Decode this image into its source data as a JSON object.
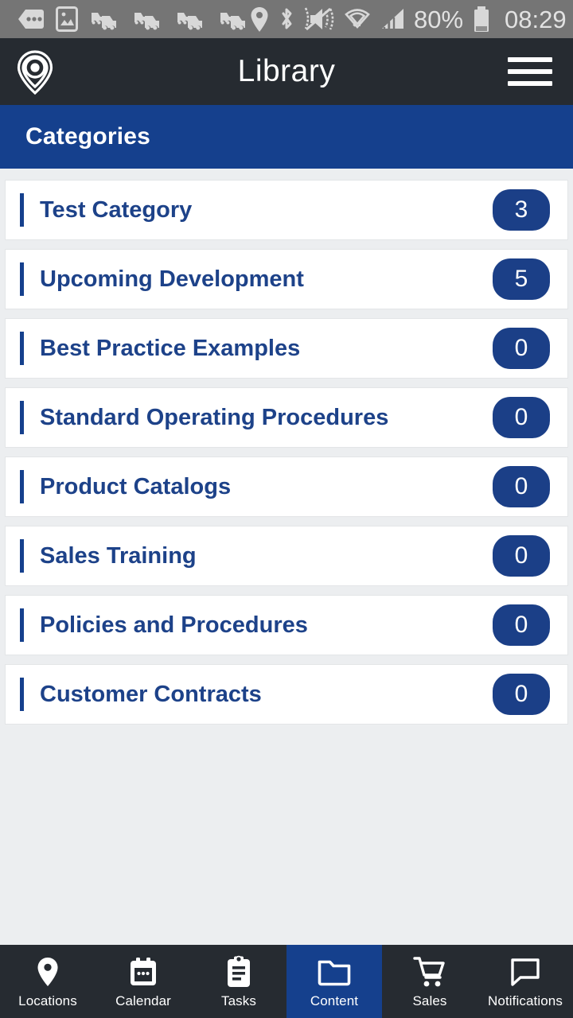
{
  "status_bar": {
    "icons_left": [
      "messages-icon",
      "image-icon",
      "traffic-icon",
      "traffic-icon",
      "traffic-icon",
      "traffic-icon"
    ],
    "icons_right": [
      "location-pin-icon",
      "bluetooth-icon",
      "vibrate-mute-icon",
      "wifi-icon",
      "cell-signal-icon"
    ],
    "battery_percent": "80%",
    "battery_icon": "battery-icon",
    "clock": "08:29",
    "background_color": "#757575",
    "text_color": "#e2e2e2"
  },
  "app_bar": {
    "logo_icon": "map-pin-layers-logo",
    "title": "Library",
    "menu_icon": "hamburger-menu-icon",
    "background_color": "#262b31"
  },
  "section_header": {
    "title": "Categories",
    "background_color": "#15408d"
  },
  "categories": [
    {
      "name": "Test Category",
      "count": "3"
    },
    {
      "name": "Upcoming Development",
      "count": "5"
    },
    {
      "name": "Best Practice Examples",
      "count": "0"
    },
    {
      "name": "Standard Operating Procedures",
      "count": "0"
    },
    {
      "name": "Product Catalogs",
      "count": "0"
    },
    {
      "name": "Sales Training",
      "count": "0"
    },
    {
      "name": "Policies and Procedures",
      "count": "0"
    },
    {
      "name": "Customer Contracts",
      "count": "0"
    }
  ],
  "theme": {
    "accent_blue": "#15408d",
    "title_blue": "#1d4289",
    "badge_blue": "#1b3f87",
    "page_background": "#eceef0",
    "card_background": "#ffffff",
    "dark_chrome": "#262b31"
  },
  "bottom_nav": {
    "active_index": 3,
    "items": [
      {
        "label": "Locations",
        "icon": "location-pin-icon"
      },
      {
        "label": "Calendar",
        "icon": "calendar-icon"
      },
      {
        "label": "Tasks",
        "icon": "clipboard-icon"
      },
      {
        "label": "Content",
        "icon": "folder-icon"
      },
      {
        "label": "Sales",
        "icon": "shopping-cart-icon"
      },
      {
        "label": "Notifications",
        "icon": "speech-bubble-icon"
      }
    ]
  }
}
